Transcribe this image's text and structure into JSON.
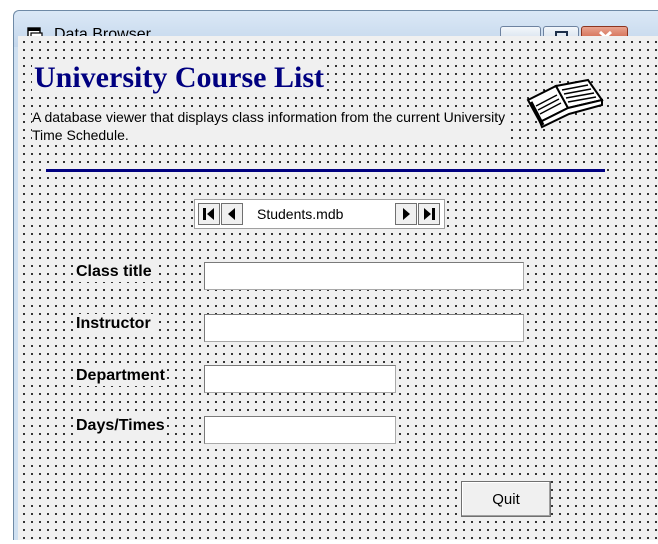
{
  "window": {
    "title": "Data Browser",
    "controls": [
      "minimize",
      "maximize",
      "close"
    ]
  },
  "form": {
    "heading": "University Course List",
    "description": "A database viewer that displays class information from the current University Time Schedule.",
    "accent_color": "#000080",
    "data_control": {
      "caption": "Students.mdb",
      "buttons": [
        "first-record",
        "previous-record",
        "next-record",
        "last-record"
      ]
    },
    "fields": [
      {
        "label": "Class title",
        "value": ""
      },
      {
        "label": "Instructor",
        "value": ""
      },
      {
        "label": "Department",
        "value": ""
      },
      {
        "label": "Days/Times",
        "value": ""
      }
    ],
    "quit_label": "Quit"
  },
  "icons": {
    "app": "form-icon",
    "decoration": "open-book-icon"
  }
}
